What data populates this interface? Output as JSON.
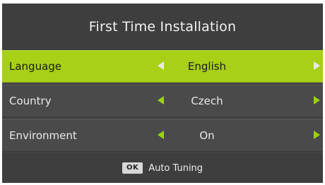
{
  "title": "First Time Installation",
  "rows": [
    {
      "label": "Language",
      "value": "English",
      "selected": true
    },
    {
      "label": "Country",
      "value": "Czech",
      "selected": false
    },
    {
      "label": "Environment",
      "value": "On",
      "selected": false
    }
  ],
  "footer": {
    "key_label": "OK",
    "action_label": "Auto Tuning"
  },
  "colors": {
    "highlight": "#a8d017",
    "panel": "#454545",
    "arrow": "#9bd30a"
  },
  "icons": {
    "left_arrow": "triangle-left-icon",
    "right_arrow": "triangle-right-icon",
    "ok_key": "ok-key-icon"
  }
}
